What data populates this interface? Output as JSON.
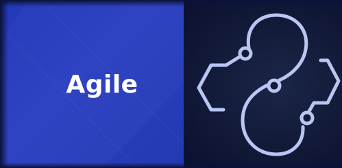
{
  "tile": {
    "label": "Agile"
  },
  "icon": {
    "name": "agile-loop-icon"
  },
  "colors": {
    "tile_blue": "#2a3fc2",
    "background_dark": "#0a1030",
    "icon_stroke": "#b9c6f2"
  }
}
